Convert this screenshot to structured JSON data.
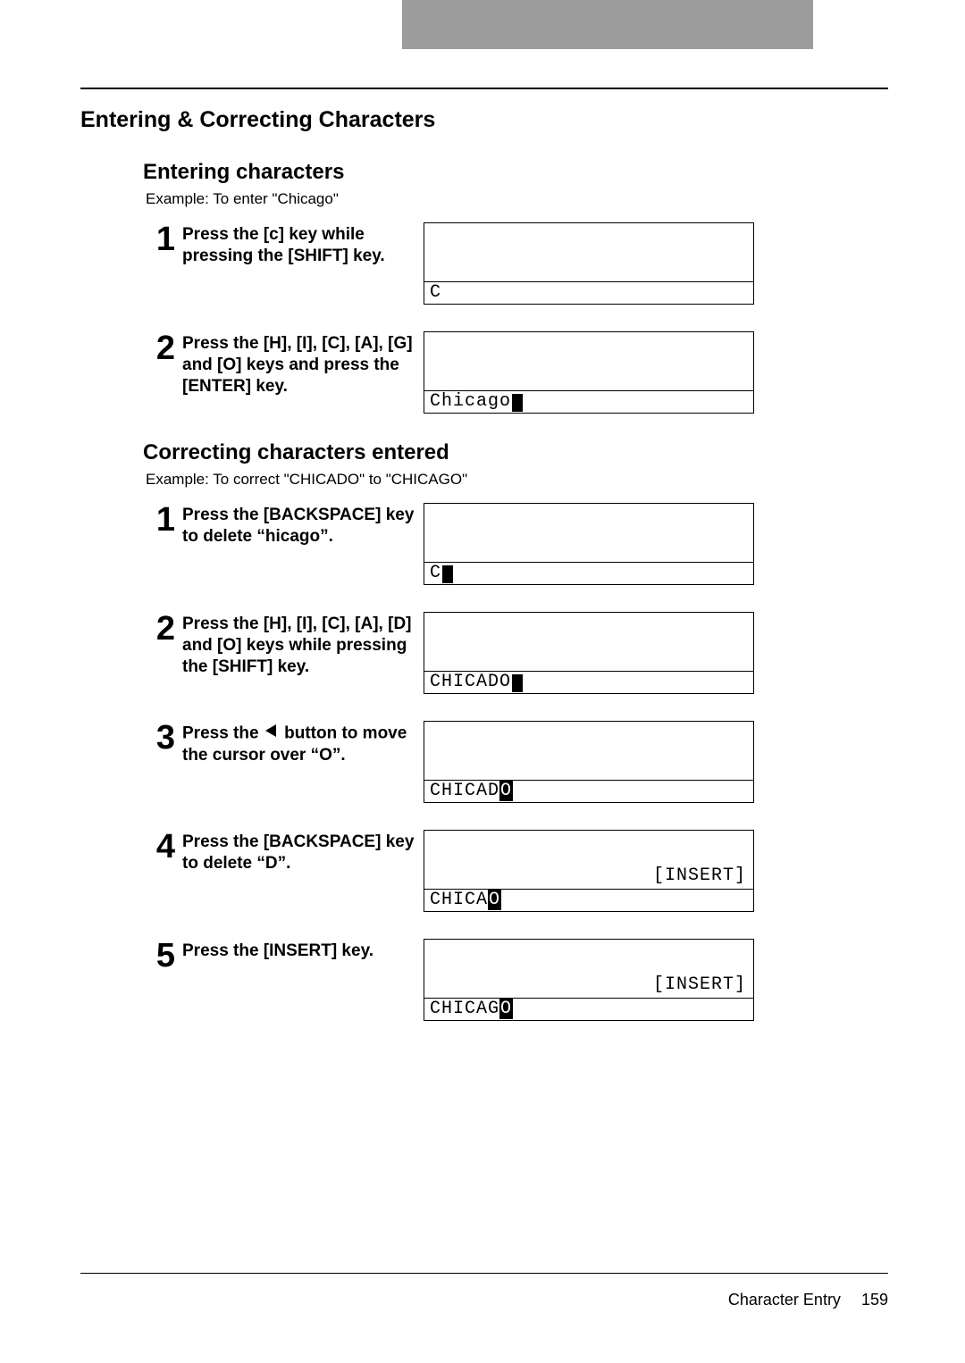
{
  "section_title": "Entering & Correcting Characters",
  "entering": {
    "heading": "Entering characters",
    "example": "Example: To enter \"Chicago\"",
    "steps": [
      {
        "num": "1",
        "text": "Press the [c] key while pressing the [SHIFT] key.",
        "display": {
          "pre": "C",
          "cursor": false,
          "hl": "",
          "post": "",
          "right": ""
        }
      },
      {
        "num": "2",
        "text": "Press the [H], [I], [C], [A], [G] and [O] keys and press the [ENTER] key.",
        "display": {
          "pre": "Chicago",
          "cursor": true,
          "hl": "",
          "post": "",
          "right": ""
        }
      }
    ]
  },
  "correcting": {
    "heading": "Correcting characters entered",
    "example": "Example: To correct \"CHICADO\" to \"CHICAGO\"",
    "steps": [
      {
        "num": "1",
        "text": "Press the [BACKSPACE] key to delete “hicago”.",
        "display": {
          "pre": "C",
          "cursor": true,
          "hl": "",
          "post": "",
          "right": ""
        }
      },
      {
        "num": "2",
        "text": "Press the [H], [I], [C], [A], [D] and [O] keys while pressing the [SHIFT] key.",
        "display": {
          "pre": "CHICADO",
          "cursor": true,
          "hl": "",
          "post": "",
          "right": ""
        }
      },
      {
        "num": "3",
        "text_pre": "Press the ",
        "text_post": " button to move the cursor over “O”.",
        "has_arrow": true,
        "display": {
          "pre": "CHICAD",
          "cursor": false,
          "hl": "O",
          "post": "",
          "right": ""
        }
      },
      {
        "num": "4",
        "text": "Press the [BACKSPACE] key to delete “D”.",
        "display": {
          "pre": "CHICA",
          "cursor": false,
          "hl": "O",
          "post": "",
          "right": "[INSERT]"
        }
      },
      {
        "num": "5",
        "text": "Press the [INSERT] key.",
        "display": {
          "pre": "CHICAG",
          "cursor": false,
          "hl": "O",
          "post": "",
          "right": "[INSERT]"
        }
      }
    ]
  },
  "footer": {
    "label": "Character Entry",
    "page": "159"
  },
  "icons": {
    "left_arrow": "left-arrow-icon"
  }
}
